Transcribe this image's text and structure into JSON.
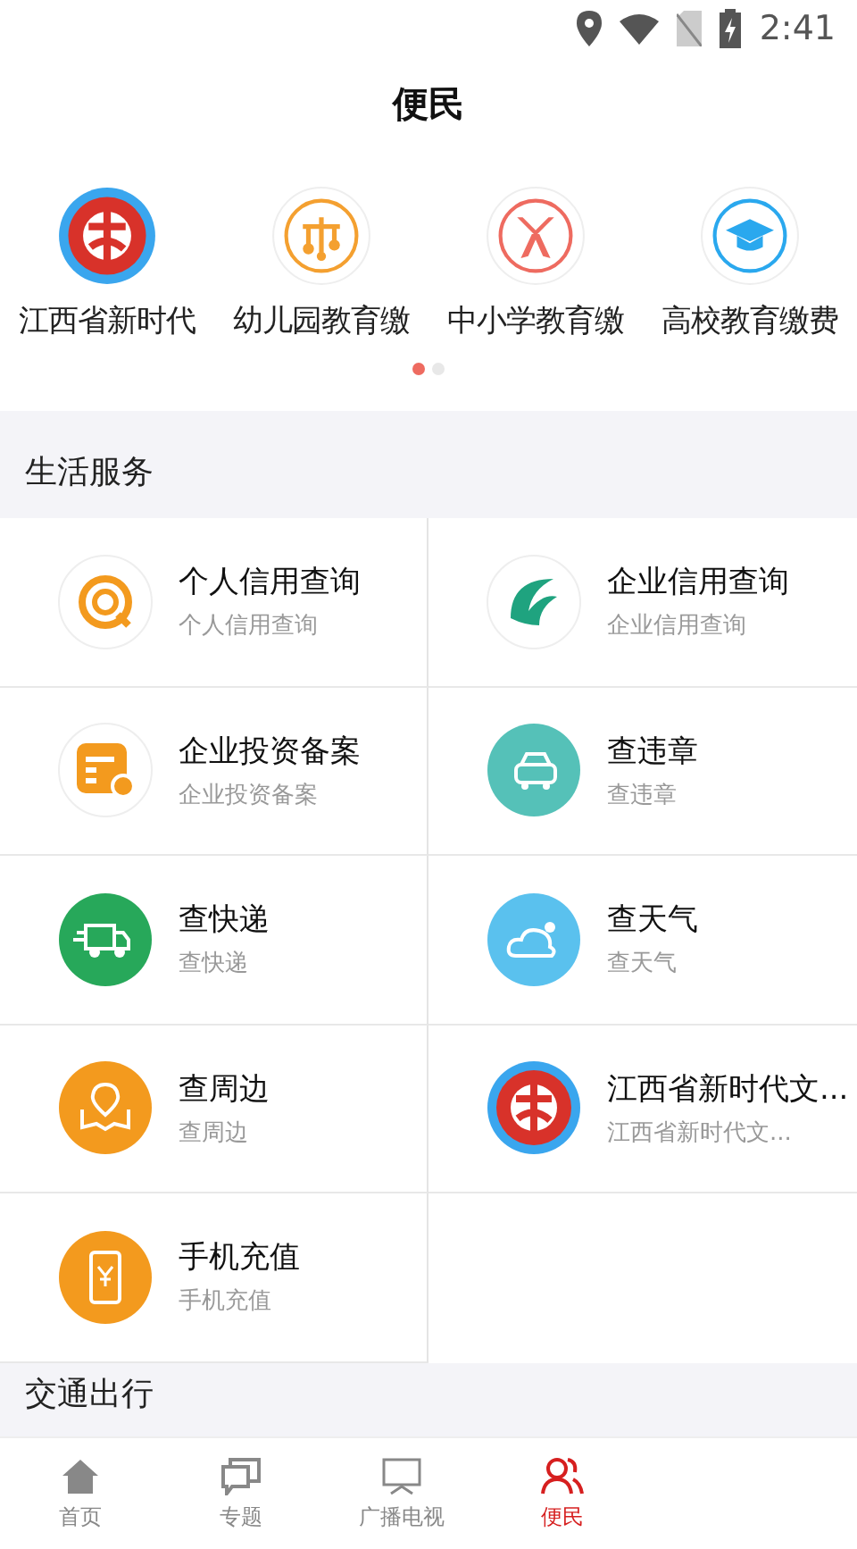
{
  "status_bar": {
    "time": "2:41"
  },
  "header": {
    "title": "便民"
  },
  "carousel": {
    "items": [
      {
        "label": "江西省新时代",
        "kind": "emblem"
      },
      {
        "label": "幼儿园教育缴",
        "kind": "mobile"
      },
      {
        "label": "中小学教育缴",
        "kind": "scarf"
      },
      {
        "label": "高校教育缴费",
        "kind": "cap"
      }
    ],
    "pages": [
      {
        "selected": true
      },
      {
        "selected": false
      }
    ]
  },
  "sections": [
    {
      "title": "生活服务",
      "items": [
        {
          "title": "个人信用查询",
          "subtitle": "个人信用查询",
          "kind": "credit"
        },
        {
          "title": "企业信用查询",
          "subtitle": "企业信用查询",
          "kind": "enterprise"
        },
        {
          "title": "企业投资备案",
          "subtitle": "企业投资备案",
          "kind": "invest"
        },
        {
          "title": "查违章",
          "subtitle": "查违章",
          "kind": "car"
        },
        {
          "title": "查快递",
          "subtitle": "查快递",
          "kind": "truck"
        },
        {
          "title": "查天气",
          "subtitle": "查天气",
          "kind": "weather"
        },
        {
          "title": "查周边",
          "subtitle": "查周边",
          "kind": "map"
        },
        {
          "title": "江西省新时代文...",
          "subtitle": "江西省新时代文...",
          "kind": "emblem"
        },
        {
          "title": "手机充值",
          "subtitle": "手机充值",
          "kind": "phone"
        }
      ]
    },
    {
      "title": "交通出行"
    }
  ],
  "bottom_nav": [
    {
      "label": "首页",
      "kind": "home",
      "selected": false
    },
    {
      "label": "专题",
      "kind": "chat",
      "selected": false
    },
    {
      "label": "广播电视",
      "kind": "tv",
      "selected": false
    },
    {
      "label": "便民",
      "kind": "people",
      "selected": true
    }
  ]
}
